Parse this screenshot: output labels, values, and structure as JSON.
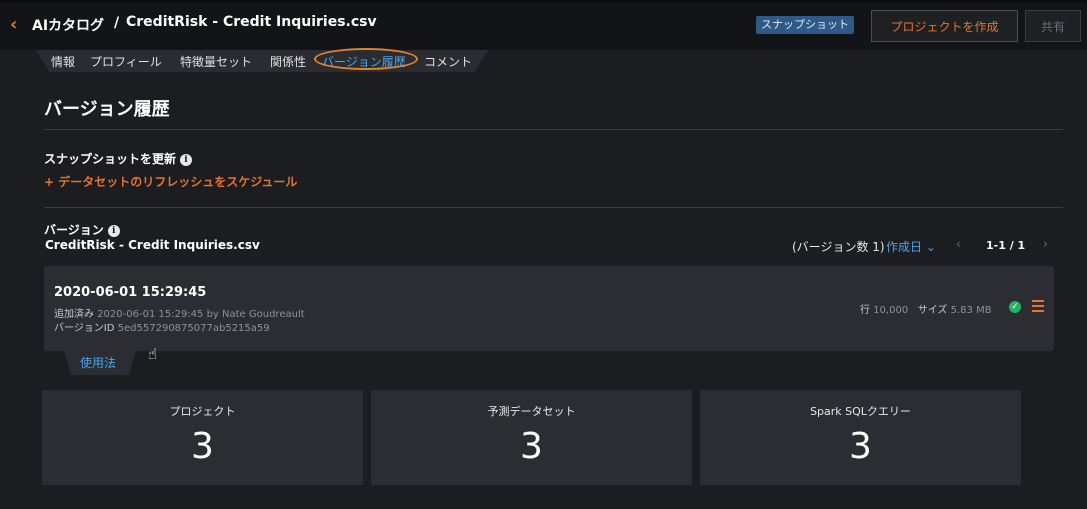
{
  "header": {
    "breadcrumb_root": "AIカタログ",
    "breadcrumb_sep": "/",
    "title": "CreditRisk - Credit Inquiries.csv",
    "snapshot_badge": "スナップショット",
    "create_project_label": "プロジェクトを作成",
    "share_label": "共有"
  },
  "tabs": [
    {
      "label": "情報",
      "active": false
    },
    {
      "label": "プロフィール",
      "active": false
    },
    {
      "label": "特徴量セット",
      "active": false
    },
    {
      "label": "関係性",
      "active": false
    },
    {
      "label": "バージョン履歴",
      "active": true
    },
    {
      "label": "コメント",
      "active": false
    }
  ],
  "page_heading": "バージョン履歴",
  "snapshot_section": {
    "label": "スナップショットを更新",
    "schedule_link": "+ データセットのリフレッシュをスケジュール"
  },
  "versions_section": {
    "label": "バージョン",
    "dataset_name": "CreditRisk - Credit Inquiries.csv",
    "version_count": "(バージョン数 1)",
    "sort_label": "作成日 ⌄",
    "pagination": "1-1 / 1"
  },
  "version": {
    "date": "2020-06-01 15:29:45",
    "added_label": "追加済み",
    "added_value": "2020-06-01 15:29:45 by Nate Goudreault",
    "id_label": "バージョンID",
    "id_value": "5ed557290875077ab5215a59",
    "rows_label": "行",
    "rows_value": "10,000",
    "size_label": "サイズ",
    "size_value": "5.83 MB",
    "status": "success"
  },
  "usage_tab_label": "使用法",
  "usage_stats": [
    {
      "label": "プロジェクト",
      "value": "3"
    },
    {
      "label": "予測データセット",
      "value": "3"
    },
    {
      "label": "Spark SQLクエリー",
      "value": "3"
    }
  ],
  "colors": {
    "accent_orange": "#e8742a",
    "link_blue": "#4aa3e8",
    "success_green": "#23b463",
    "background": "#1b1d21",
    "card": "#2b2d32"
  }
}
